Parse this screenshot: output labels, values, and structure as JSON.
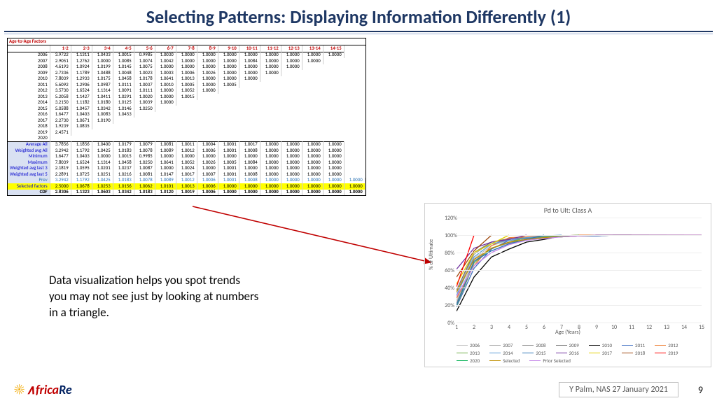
{
  "title": "Selecting Patterns: Displaying Information Differently (1)",
  "body_text": "Data visualization helps you spot trends you may not see just by looking at numbers in a triangle.",
  "footer": {
    "brand_a": "∧frica",
    "brand_b": "Re",
    "caption": "Y Palm, NAS 27 January 2021",
    "page": "9"
  },
  "table": {
    "caption": "Age-to-Age Factors",
    "cols": [
      "1-2",
      "2-3",
      "3-4",
      "4-5",
      "5-6",
      "6-7",
      "7-8",
      "8-9",
      "9-10",
      "10-11",
      "11-12",
      "12-13",
      "13-14",
      "14-15"
    ],
    "years": [
      "2006",
      "2007",
      "2008",
      "2009",
      "2010",
      "2011",
      "2012",
      "2013",
      "2014",
      "2015",
      "2016",
      "2017",
      "2018",
      "2019",
      "2020"
    ],
    "rows": [
      [
        "3.9722",
        "1.1311",
        "1.0433",
        "1.0015",
        "0.9985",
        "1.0030",
        "1.0000",
        "1.0000",
        "1.0000",
        "1.0000",
        "1.0000",
        "1.0000",
        "1.0000",
        "1.0000"
      ],
      [
        "2.9051",
        "1.2762",
        "1.0000",
        "1.0085",
        "1.0074",
        "1.0042",
        "1.0000",
        "1.0000",
        "1.0000",
        "1.0084",
        "1.0000",
        "1.0000",
        "1.0000"
      ],
      [
        "4.6193",
        "1.0924",
        "1.0199",
        "1.0145",
        "1.0075",
        "1.0000",
        "1.0000",
        "1.0000",
        "1.0000",
        "1.0000",
        "1.0000",
        "1.0000"
      ],
      [
        "2.7336",
        "1.1789",
        "1.0488",
        "1.0048",
        "1.0023",
        "1.0003",
        "1.0006",
        "1.0026",
        "1.0000",
        "1.0000",
        "1.0000"
      ],
      [
        "7.8039",
        "1.2933",
        "1.0175",
        "1.0458",
        "1.0178",
        "1.0641",
        "1.0013",
        "1.0000",
        "1.0000",
        "1.0000"
      ],
      [
        "5.6092",
        "1.2906",
        "1.0987",
        "1.0111",
        "1.0037",
        "1.0010",
        "1.0005",
        "1.0000",
        "1.0005"
      ],
      [
        "3.5730",
        "1.6524",
        "1.1314",
        "1.0091",
        "1.0111",
        "1.0000",
        "1.0052",
        "1.0000"
      ],
      [
        "5.2058",
        "1.1427",
        "1.0411",
        "1.0291",
        "1.0020",
        "1.0000",
        "1.0015"
      ],
      [
        "3.2150",
        "1.1182",
        "1.0180",
        "1.0125",
        "1.0039",
        "1.0000"
      ],
      [
        "5.0588",
        "1.0457",
        "1.0342",
        "1.0146",
        "1.0250"
      ],
      [
        "1.6477",
        "1.0403",
        "1.0083",
        "1.0453"
      ],
      [
        "2.2730",
        "1.0671",
        "1.0190"
      ],
      [
        "1.9239",
        "1.0835"
      ],
      [
        "2.4571"
      ],
      []
    ],
    "summary": [
      {
        "l": "Average All",
        "v": [
          "3.7856",
          "1.1856",
          "1.0400",
          "1.0179",
          "1.0079",
          "1.0081",
          "1.0011",
          "1.0004",
          "1.0001",
          "1.0017",
          "1.0000",
          "1.0000",
          "1.0000",
          "1.0000"
        ]
      },
      {
        "l": "Weighted avg All",
        "v": [
          "3.2942",
          "1.1792",
          "1.0425",
          "1.0183",
          "1.0078",
          "1.0089",
          "1.0012",
          "1.0006",
          "1.0001",
          "1.0008",
          "1.0000",
          "1.0000",
          "1.0000",
          "1.0000"
        ]
      },
      {
        "l": "Minimum",
        "v": [
          "1.6477",
          "1.0403",
          "1.0000",
          "1.0015",
          "0.9985",
          "1.0000",
          "1.0000",
          "1.0000",
          "1.0000",
          "1.0000",
          "1.0000",
          "1.0000",
          "1.0000",
          "1.0000"
        ]
      },
      {
        "l": "Maximum",
        "v": [
          "7.8039",
          "1.6524",
          "1.1314",
          "1.0458",
          "1.0250",
          "1.0641",
          "1.0052",
          "1.0026",
          "1.0005",
          "1.0084",
          "1.0000",
          "1.0000",
          "1.0000",
          "1.0000"
        ]
      },
      {
        "l": "Weighted avg last 3",
        "v": [
          "2.1819",
          "1.0595",
          "1.0201",
          "1.0237",
          "1.0087",
          "1.0000",
          "1.0024",
          "1.0000",
          "1.0001",
          "1.0000",
          "1.0000",
          "1.0000",
          "1.0000",
          "1.0000"
        ]
      },
      {
        "l": "Weighted avg last 5",
        "v": [
          "2.2891",
          "1.0725",
          "1.0251",
          "1.0216",
          "1.0081",
          "1.0147",
          "1.0017",
          "1.0007",
          "1.0001",
          "1.0008",
          "1.0000",
          "1.0000",
          "1.0000",
          "1.0000"
        ]
      },
      {
        "l": "Prev",
        "c": "row-prev",
        "v": [
          "3.2942",
          "1.1792",
          "1.0425",
          "1.0183",
          "1.0078",
          "1.0089",
          "1.0012",
          "1.0006",
          "1.0001",
          "1.0008",
          "1.0000",
          "1.0000",
          "1.0000",
          "1.0000",
          "1.0000"
        ]
      },
      {
        "l": "Selected factors",
        "c": "row-selected",
        "v": [
          "2.5000",
          "1.0678",
          "1.0253",
          "1.0156",
          "1.0062",
          "1.0101",
          "1.0013",
          "1.0006",
          "1.0000",
          "1.0000",
          "1.0000",
          "1.0000",
          "1.0000",
          "1.0000",
          "1.0000"
        ]
      },
      {
        "l": "CDF",
        "c": "row-cdf",
        "v": [
          "2.8306",
          "1.1323",
          "1.0603",
          "1.0342",
          "1.0183",
          "1.0120",
          "1.0019",
          "1.0006",
          "1.0000",
          "1.0000",
          "1.0000",
          "1.0000",
          "1.0000",
          "1.0000",
          "1.0000"
        ]
      }
    ]
  },
  "chart_data": {
    "type": "line",
    "title": "Pd to Ult: Class A",
    "xlabel": "Age (Years)",
    "ylabel": "% of Ultimate",
    "x": [
      1,
      2,
      3,
      4,
      5,
      6,
      7,
      8,
      9,
      10,
      11,
      12,
      13,
      14,
      15
    ],
    "xlim": [
      1,
      15
    ],
    "ylim": [
      0,
      120
    ],
    "yticks": [
      0,
      20,
      40,
      60,
      80,
      100,
      120
    ],
    "legend_position": "bottom",
    "series": [
      {
        "name": "2006",
        "color": "#bfbfbf",
        "values": [
          25,
          73,
          88,
          94,
          96,
          97,
          98,
          99,
          99,
          100,
          100,
          100,
          100,
          100,
          100
        ]
      },
      {
        "name": "2007",
        "color": "#a6a6a6",
        "values": [
          34,
          78,
          92,
          94,
          96,
          97,
          98,
          99,
          99,
          100,
          100,
          100,
          100,
          100
        ]
      },
      {
        "name": "2008",
        "color": "#8c8c8c",
        "values": [
          22,
          70,
          85,
          91,
          95,
          97,
          98,
          99,
          99,
          100,
          100,
          100,
          100
        ]
      },
      {
        "name": "2009",
        "color": "#737373",
        "values": [
          37,
          80,
          92,
          96,
          97,
          98,
          99,
          99,
          100,
          100,
          100,
          100
        ]
      },
      {
        "name": "2010",
        "color": "#000000",
        "values": [
          13,
          52,
          75,
          84,
          92,
          95,
          99,
          99,
          100,
          100,
          100
        ]
      },
      {
        "name": "2011",
        "color": "#4472c4",
        "values": [
          18,
          62,
          84,
          94,
          96,
          97,
          98,
          99,
          99,
          100
        ]
      },
      {
        "name": "2012",
        "color": "#ed7d31",
        "values": [
          28,
          65,
          88,
          97,
          98,
          99,
          99,
          100,
          100
        ]
      },
      {
        "name": "2013",
        "color": "#70ad47",
        "values": [
          19,
          68,
          85,
          92,
          97,
          98,
          99,
          100
        ]
      },
      {
        "name": "2014",
        "color": "#5b9bd5",
        "values": [
          31,
          75,
          90,
          94,
          97,
          99,
          100
        ]
      },
      {
        "name": "2015",
        "color": "#2e75b6",
        "values": [
          20,
          70,
          82,
          90,
          95,
          100
        ]
      },
      {
        "name": "2016",
        "color": "#7030a0",
        "values": [
          61,
          85,
          92,
          95,
          100
        ]
      },
      {
        "name": "2017",
        "color": "#e2cf00",
        "values": [
          44,
          80,
          90,
          100
        ]
      },
      {
        "name": "2018",
        "color": "#9e480e",
        "values": [
          52,
          82,
          100
        ]
      },
      {
        "name": "2019",
        "color": "#ff0000",
        "values": [
          41,
          100
        ]
      },
      {
        "name": "2020",
        "color": "#00b050",
        "values": [
          100
        ]
      },
      {
        "name": "Selected",
        "color": "#bf8f00",
        "values": [
          35,
          72,
          85,
          92,
          95,
          97,
          98,
          99,
          100,
          100,
          100,
          100,
          100,
          100,
          100
        ]
      },
      {
        "name": "Prior Selected",
        "color": "#c586e8",
        "values": [
          30,
          65,
          80,
          89,
          94,
          96,
          98,
          99,
          100,
          100,
          100,
          100,
          100,
          100,
          100
        ]
      }
    ]
  }
}
